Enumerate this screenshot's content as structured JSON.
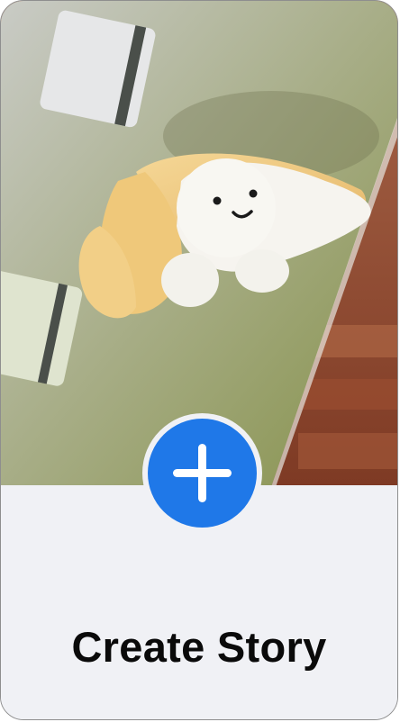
{
  "card": {
    "label": "Create Story",
    "plus_icon": "plus-icon",
    "accent_color": "#1f78e8",
    "background_color": "#f0f1f5"
  },
  "photo": {
    "subject": "photo-thumbnail"
  }
}
